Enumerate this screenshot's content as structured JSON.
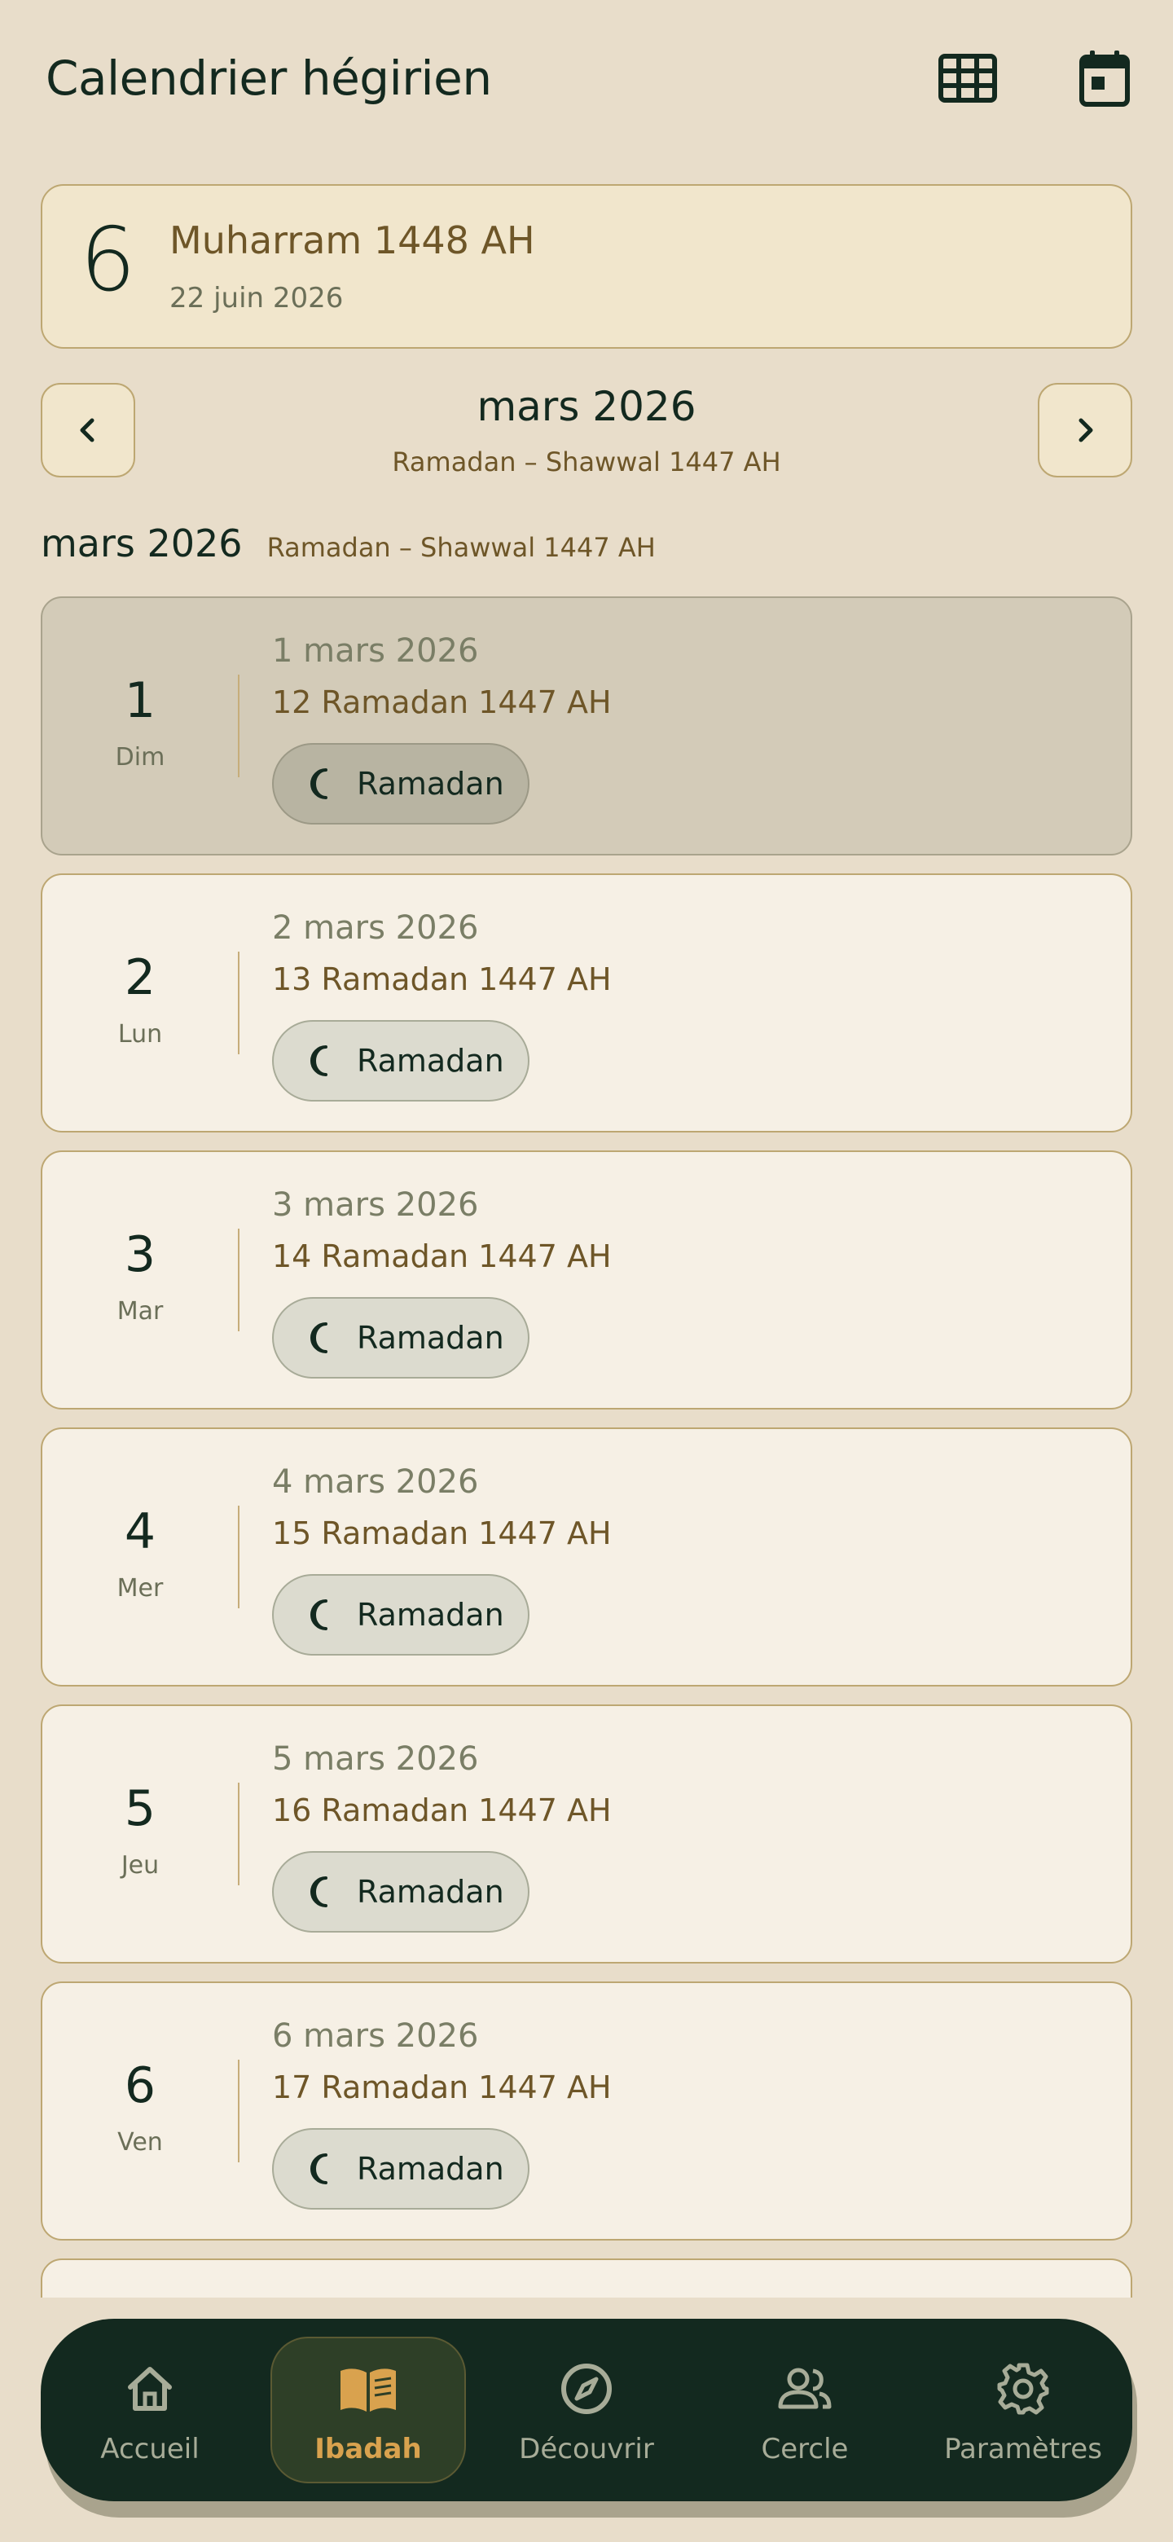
{
  "header": {
    "title": "Calendrier hégirien",
    "icons": {
      "grid": "grid-view-icon",
      "calendar": "calendar-today-icon"
    }
  },
  "today": {
    "day": "6",
    "hijri": "Muharram 1448 AH",
    "gregorian": "22 juin 2026"
  },
  "month_nav": {
    "title": "mars 2026",
    "subtitle": "Ramadan – Shawwal 1447 AH"
  },
  "section": {
    "month": "mars 2026",
    "subtitle": "Ramadan – Shawwal 1447 AH"
  },
  "days": [
    {
      "num": "1",
      "weekday": "Dim",
      "gregorian": "1 mars 2026",
      "hijri": "12 Ramadan 1447 AH",
      "tag": "Ramadan",
      "selected": true
    },
    {
      "num": "2",
      "weekday": "Lun",
      "gregorian": "2 mars 2026",
      "hijri": "13 Ramadan 1447 AH",
      "tag": "Ramadan"
    },
    {
      "num": "3",
      "weekday": "Mar",
      "gregorian": "3 mars 2026",
      "hijri": "14 Ramadan 1447 AH",
      "tag": "Ramadan"
    },
    {
      "num": "4",
      "weekday": "Mer",
      "gregorian": "4 mars 2026",
      "hijri": "15 Ramadan 1447 AH",
      "tag": "Ramadan"
    },
    {
      "num": "5",
      "weekday": "Jeu",
      "gregorian": "5 mars 2026",
      "hijri": "16 Ramadan 1447 AH",
      "tag": "Ramadan"
    },
    {
      "num": "6",
      "weekday": "Ven",
      "gregorian": "6 mars 2026",
      "hijri": "17 Ramadan 1447 AH",
      "tag": "Ramadan"
    }
  ],
  "bottom_nav": {
    "items": [
      {
        "label": "Accueil",
        "icon": "home-icon"
      },
      {
        "label": "Ibadah",
        "icon": "book-icon",
        "active": true
      },
      {
        "label": "Découvrir",
        "icon": "compass-icon"
      },
      {
        "label": "Cercle",
        "icon": "people-icon"
      },
      {
        "label": "Paramètres",
        "icon": "gear-icon"
      }
    ]
  },
  "colors": {
    "background": "#E8DDCA",
    "primary_dark": "#13291F",
    "accent_gold": "#D9A24E",
    "hijri_brown": "#6E5628",
    "card": "#F6F0E5",
    "card_selected": "#D3CBB8"
  }
}
